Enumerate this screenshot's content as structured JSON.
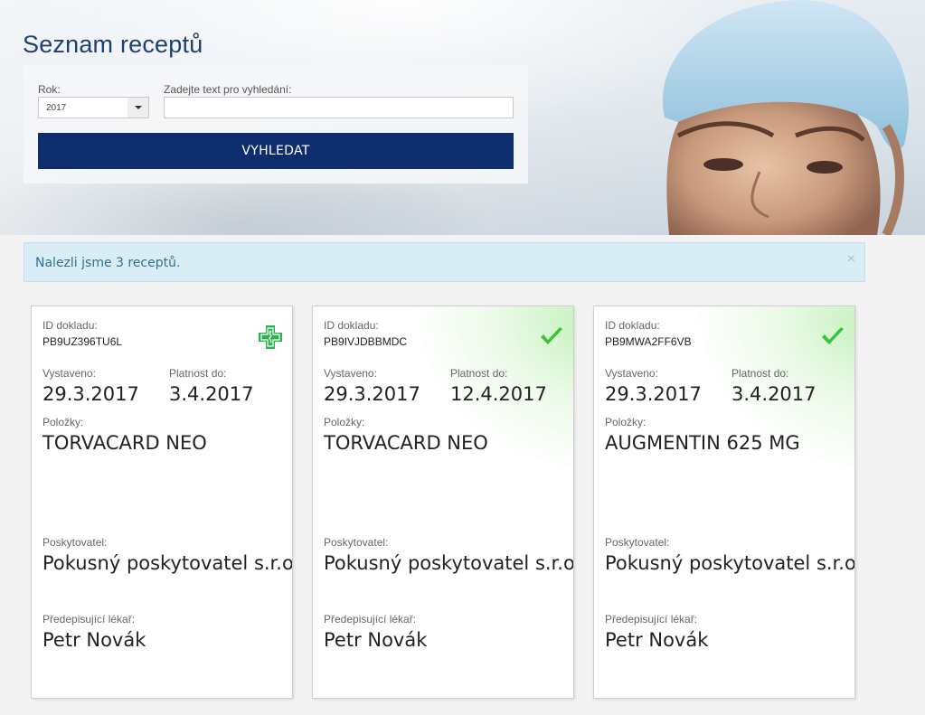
{
  "page": {
    "title": "Seznam receptů"
  },
  "search": {
    "year_label": "Rok:",
    "year_value": "2017",
    "text_label": "Zadejte text pro vyhledání:",
    "text_value": "",
    "text_placeholder": "",
    "button_label": "VYHLEDAT"
  },
  "alert": {
    "message": "Nalezli jsme 3 receptů.",
    "close_symbol": "×"
  },
  "labels": {
    "id": "ID dokladu:",
    "issued": "Vystaveno:",
    "valid_until": "Platnost do:",
    "items": "Položky:",
    "provider": "Poskytovatel:",
    "doctor": "Předepisující lékař:"
  },
  "cards": [
    {
      "id": "PB9UZ396TU6L",
      "issued": "29.3.2017",
      "valid_until": "3.4.2017",
      "items": "TORVACARD NEO",
      "provider": "Pokusný poskytovatel s.r.o.",
      "doctor": "Petr Novák",
      "status": "pharmacy-cross-icon",
      "status_color": "#2bb24c"
    },
    {
      "id": "PB9IVJDBBMDC",
      "issued": "29.3.2017",
      "valid_until": "12.4.2017",
      "items": "TORVACARD NEO",
      "provider": "Pokusný poskytovatel s.r.o.",
      "doctor": "Petr Novák",
      "status": "checkmark-icon",
      "status_color": "#3cc23c"
    },
    {
      "id": "PB9MWA2FF6VB",
      "issued": "29.3.2017",
      "valid_until": "3.4.2017",
      "items": "AUGMENTIN 625 MG",
      "provider": "Pokusný poskytovatel s.r.o.",
      "doctor": "Petr Novák",
      "status": "checkmark-icon",
      "status_color": "#3cc23c"
    }
  ],
  "colors": {
    "title": "#1f3f73",
    "button": "#0d2d6e",
    "alert_bg": "#d9edf7",
    "alert_text": "#31708f"
  }
}
